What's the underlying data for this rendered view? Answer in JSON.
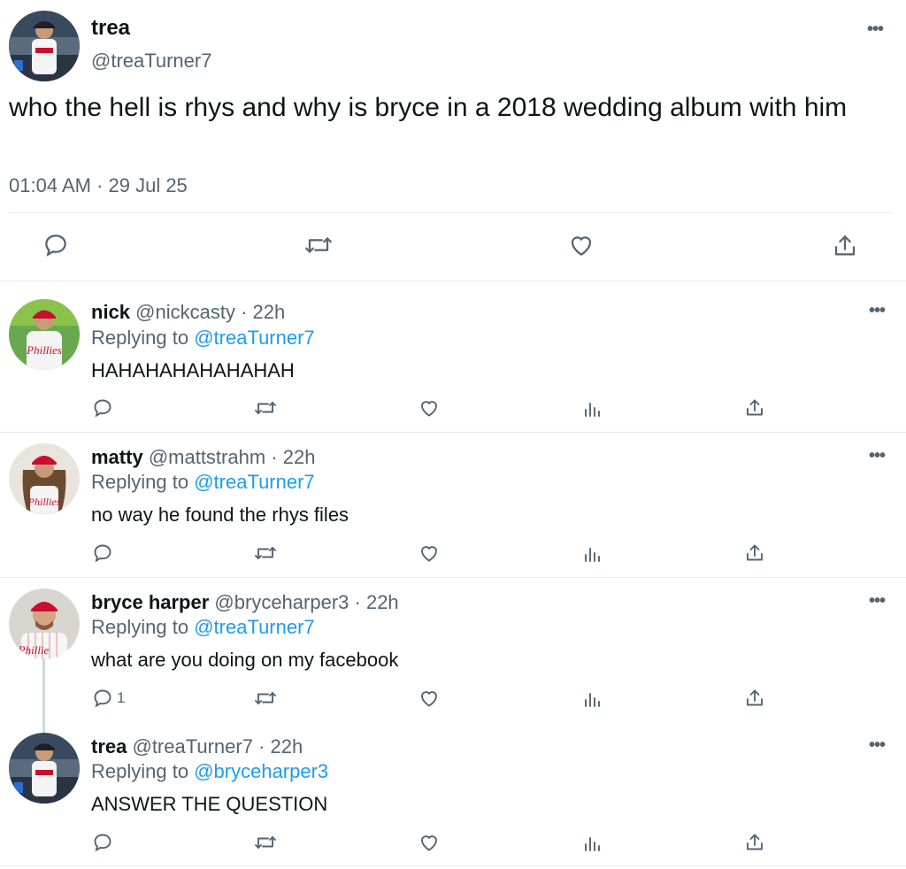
{
  "main_tweet": {
    "name": "trea",
    "handle": "@treaTurner7",
    "text": "who the hell is rhys and why is bryce in a 2018 wedding album with him",
    "timestamp": "01:04 AM · 29 Jul 25",
    "more_icon": "•••",
    "actions": [
      "reply-icon",
      "retweet-icon",
      "like-icon",
      "share-icon"
    ]
  },
  "replies": [
    {
      "name": "nick",
      "handle": "@nickcasty",
      "time": "· 22h",
      "replying_prefix": "Replying to",
      "replying_to": "@treaTurner7",
      "text": "HAHAHAHAHAHAHAH",
      "reply_count": ""
    },
    {
      "name": "matty",
      "handle": "@mattstrahm",
      "time": "· 22h",
      "replying_prefix": "Replying to",
      "replying_to": "@treaTurner7",
      "text": "no way he found the rhys files",
      "reply_count": ""
    },
    {
      "name": "bryce harper",
      "handle": "@bryceharper3",
      "time": "· 22h",
      "replying_prefix": "Replying to",
      "replying_to": "@treaTurner7",
      "text": "what are you doing on my facebook",
      "reply_count": "1"
    },
    {
      "name": "trea",
      "handle": "@treaTurner7",
      "time": "· 22h",
      "replying_prefix": "Replying to",
      "replying_to": "@bryceharper3",
      "text": "ANSWER THE QUESTION",
      "reply_count": ""
    }
  ],
  "colors": {
    "text": "#0f1419",
    "secondary": "#536471",
    "link": "#1d9bf0",
    "divider": "#e6e9eb",
    "phillies_red": "#c8102e"
  }
}
